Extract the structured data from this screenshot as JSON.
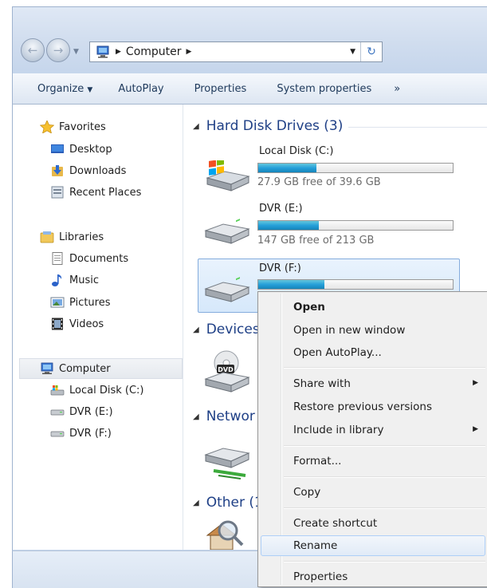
{
  "address_bar": {
    "segment": "Computer",
    "icon": "computer-icon",
    "refresh_icon": "refresh-icon"
  },
  "toolbar": {
    "organize": "Organize",
    "autoplay": "AutoPlay",
    "properties": "Properties",
    "system_properties": "System properties",
    "more": "»"
  },
  "nav": {
    "favorites": {
      "label": "Favorites",
      "icon": "star-icon",
      "items": [
        {
          "label": "Desktop",
          "icon": "desktop-icon"
        },
        {
          "label": "Downloads",
          "icon": "downloads-icon"
        },
        {
          "label": "Recent Places",
          "icon": "recent-places-icon"
        }
      ]
    },
    "libraries": {
      "label": "Libraries",
      "icon": "libraries-icon",
      "items": [
        {
          "label": "Documents",
          "icon": "documents-icon"
        },
        {
          "label": "Music",
          "icon": "music-icon"
        },
        {
          "label": "Pictures",
          "icon": "pictures-icon"
        },
        {
          "label": "Videos",
          "icon": "videos-icon"
        }
      ]
    },
    "computer": {
      "label": "Computer",
      "icon": "computer-icon",
      "items": [
        {
          "label": "Local Disk (C:)",
          "icon": "windows-drive-icon"
        },
        {
          "label": "DVR (E:)",
          "icon": "drive-icon"
        },
        {
          "label": "DVR (F:)",
          "icon": "drive-icon"
        }
      ]
    }
  },
  "content": {
    "groups": {
      "hard_disks": "Hard Disk Drives (3)",
      "devices": "Devices",
      "network": "Networ",
      "other": "Other (1"
    },
    "drives": [
      {
        "name": "Local Disk (C:)",
        "free_text": "27.9 GB free of 39.6 GB",
        "used_fraction": 0.3
      },
      {
        "name": "DVR (E:)",
        "free_text": "147 GB free of 213 GB",
        "used_fraction": 0.31
      },
      {
        "name": "DVR (F:)",
        "free_text": "",
        "used_fraction": 0.34
      }
    ]
  },
  "context_menu": {
    "open": "Open",
    "open_new_window": "Open in new window",
    "open_autoplay": "Open AutoPlay...",
    "share_with": "Share with",
    "restore_previous": "Restore previous versions",
    "include_in_library": "Include in library",
    "format": "Format...",
    "copy": "Copy",
    "create_shortcut": "Create shortcut",
    "rename": "Rename",
    "properties": "Properties",
    "highlighted": "Rename"
  },
  "colors": {
    "accent": "#26a0da",
    "group_header": "#1e3f86",
    "menu_hover_border": "#aecff7"
  }
}
